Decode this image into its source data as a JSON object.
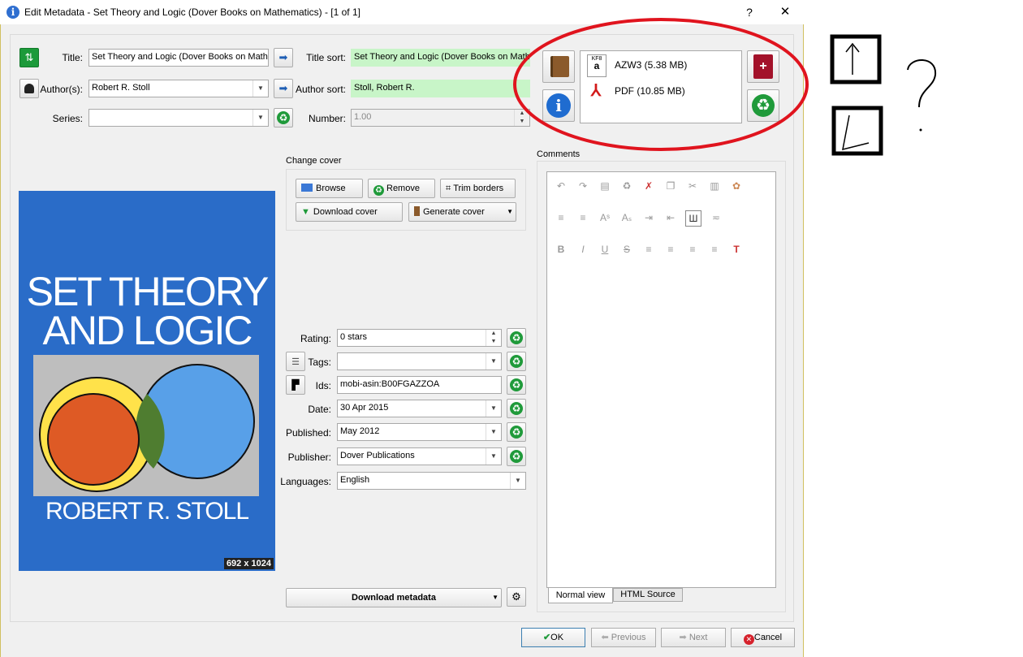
{
  "window": {
    "title": "Edit Metadata - Set Theory and Logic (Dover Books on Mathematics) -  [1 of 1]",
    "help_label": "?",
    "close_label": "✕"
  },
  "fields": {
    "title_label": "Title:",
    "title_value": "Set Theory and Logic (Dover Books on Mathematics)",
    "title_sort_label": "Title sort:",
    "title_sort_value": "Set Theory and Logic (Dover Books on Mathematics)",
    "authors_label": "Author(s):",
    "authors_value": "Robert R. Stoll",
    "author_sort_label": "Author sort:",
    "author_sort_value": "Stoll, Robert R.",
    "series_label": "Series:",
    "series_value": "",
    "number_label": "Number:",
    "number_value": "1.00"
  },
  "formats": [
    {
      "name": "AZW3 (5.38 MB)",
      "icon": "kf8-amazon-icon"
    },
    {
      "name": "PDF (10.85 MB)",
      "icon": "pdf-icon"
    }
  ],
  "cover": {
    "title_line1": "SET THEORY",
    "title_line2": "AND LOGIC",
    "author": "ROBERT R. STOLL",
    "dimensions": "692 x 1024"
  },
  "change_cover": {
    "label": "Change cover",
    "browse": "Browse",
    "remove": "Remove",
    "trim": "Trim borders",
    "download": "Download cover",
    "generate": "Generate cover"
  },
  "meta": {
    "rating_label": "Rating:",
    "rating_value": "0 stars",
    "tags_label": "Tags:",
    "tags_value": "",
    "ids_label": "Ids:",
    "ids_value": "mobi-asin:B00FGAZZOA",
    "date_label": "Date:",
    "date_value": "30 Apr 2015",
    "published_label": "Published:",
    "published_value": "May 2012",
    "publisher_label": "Publisher:",
    "publisher_value": "Dover Publications",
    "languages_label": "Languages:",
    "languages_value": "English"
  },
  "comments": {
    "label": "Comments",
    "tab_normal": "Normal view",
    "tab_html": "HTML Source"
  },
  "download_metadata": "Download metadata",
  "footer": {
    "ok": "OK",
    "previous": "Previous",
    "next": "Next",
    "cancel": "Cancel"
  },
  "annotation": {
    "question": "?"
  },
  "colors": {
    "accent_green": "#c8f5c8",
    "cover_blue": "#2a6cc8",
    "annotation_red": "#e0141e"
  }
}
